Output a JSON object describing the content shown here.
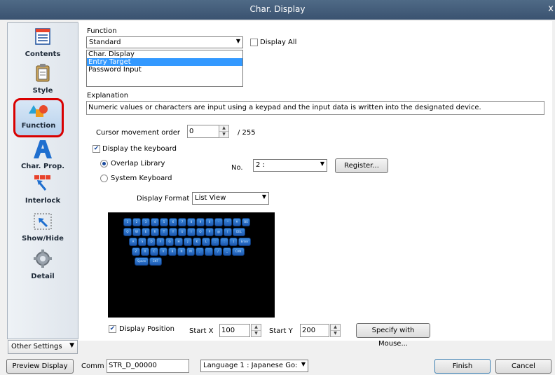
{
  "window": {
    "title": "Char. Display",
    "close_glyph": "x"
  },
  "sidebar": {
    "items": [
      {
        "label": "Contents",
        "icon": "contents-icon"
      },
      {
        "label": "Style",
        "icon": "style-icon"
      },
      {
        "label": "Function",
        "icon": "function-icon",
        "active": true
      },
      {
        "label": "Char. Prop.",
        "icon": "char-prop-icon"
      },
      {
        "label": "Interlock",
        "icon": "interlock-icon"
      },
      {
        "label": "Show/Hide",
        "icon": "show-hide-icon"
      },
      {
        "label": "Detail",
        "icon": "detail-icon"
      }
    ],
    "other_settings": "Other Settings"
  },
  "function": {
    "label": "Function",
    "selected": "Standard",
    "display_all": "Display All",
    "list": [
      "Char. Display",
      "Entry Target",
      "Password Input"
    ],
    "list_selected_index": 1
  },
  "explanation": {
    "label": "Explanation",
    "text": "Numeric values or characters are input using a keypad and the input data is written into the designated device."
  },
  "cursor": {
    "label": "Cursor movement order",
    "value": "0",
    "max": "/ 255"
  },
  "keyboard": {
    "display_label": "Display the keyboard",
    "display_checked": true,
    "overlap_label": "Overlap Library",
    "system_label": "System Keyboard",
    "no_label": "No.",
    "no_value": "2 :",
    "register": "Register...",
    "format_label": "Display Format",
    "format_value": "List View",
    "rows": [
      [
        "1",
        "2",
        "3",
        "4",
        "5",
        "6",
        "7",
        "8",
        "9",
        "0",
        "-",
        "^",
        "¥",
        "BS"
      ],
      [
        "Q",
        "W",
        "E",
        "R",
        "T",
        "Y",
        "U",
        "I",
        "O",
        "P",
        "@",
        "[",
        "DEL"
      ],
      [
        "A",
        "S",
        "D",
        "F",
        "G",
        "H",
        "J",
        "K",
        "L",
        ";",
        ":",
        "]",
        "Enter"
      ],
      [
        "Z",
        "X",
        "C",
        "V",
        "B",
        "N",
        "M",
        ",",
        ".",
        "/",
        "_",
        "CAN"
      ],
      [
        "Space",
        "ENT"
      ]
    ]
  },
  "position": {
    "label": "Display Position",
    "checked": true,
    "start_x_label": "Start X",
    "start_x": "100",
    "start_y_label": "Start Y",
    "start_y": "200",
    "specify": "Specify with Mouse..."
  },
  "footer": {
    "preview": "Preview Display",
    "comm_label": "Comm",
    "comm_value": "STR_D_00000",
    "language": "Language 1 : Japanese Go:",
    "finish": "Finish",
    "cancel": "Cancel"
  },
  "colors": {
    "title_bg": "#3f5774",
    "highlight": "#d90000",
    "selection": "#3399ff",
    "key": "#2a6fcc"
  }
}
